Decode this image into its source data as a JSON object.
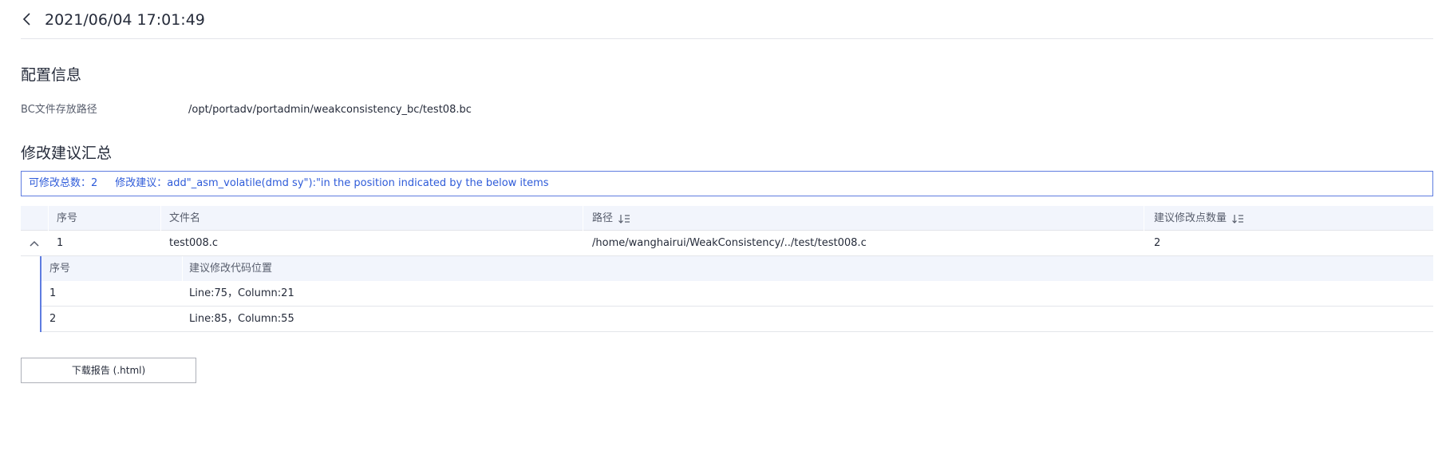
{
  "header": {
    "title": "2021/06/04 17:01:49"
  },
  "config": {
    "section_title": "配置信息",
    "bc_path_label": "BC文件存放路径",
    "bc_path_value": "/opt/portadv/portadmin/weakconsistency_bc/test08.bc"
  },
  "summary": {
    "section_title": "修改建议汇总",
    "total_text": "可修改总数：2",
    "suggestion_text": "修改建议：add\"_asm_volatile(dmd sy\"):\"in the position indicated by the below items"
  },
  "table": {
    "columns": [
      "序号",
      "文件名",
      "路径",
      "建议修改点数量"
    ],
    "rows": [
      {
        "index": "1",
        "file": "test008.c",
        "path": "/home/wanghairui/WeakConsistency/../test/test008.c",
        "count": "2"
      }
    ],
    "sub_columns": [
      "序号",
      "建议修改代码位置"
    ],
    "sub_rows": [
      {
        "index": "1",
        "position": "Line:75，Column:21"
      },
      {
        "index": "2",
        "position": "Line:85，Column:55"
      }
    ]
  },
  "actions": {
    "download_label": "下载报告 (.html)"
  },
  "icons": {
    "back": "chevron-left-icon",
    "sort": "sort-icon",
    "expand": "chevron-up-icon"
  },
  "colors": {
    "accent": "#5e7ce0",
    "accent_text": "#2e5bd9",
    "header_bg": "#f2f5fc",
    "border": "#e3e5ea"
  }
}
